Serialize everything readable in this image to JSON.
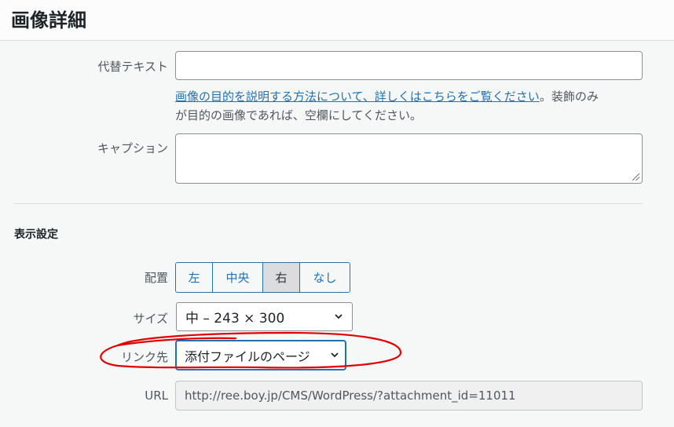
{
  "header": {
    "title": "画像詳細"
  },
  "alt_text": {
    "label": "代替テキスト",
    "value": "",
    "help_link": "画像の目的を説明する方法について、詳しくはこちらをご覧ください",
    "help_suffix": "。装飾のみ",
    "help_line2": "が目的の画像であれば、空欄にしてください。"
  },
  "caption": {
    "label": "キャプション",
    "value": ""
  },
  "display_settings": {
    "title": "表示設定",
    "align": {
      "label": "配置",
      "options": [
        "左",
        "中央",
        "右",
        "なし"
      ],
      "selected": "右"
    },
    "size": {
      "label": "サイズ",
      "value": "中 – 243 × 300"
    },
    "link_to": {
      "label": "リンク先",
      "value": "添付ファイルのページ"
    },
    "url": {
      "label": "URL",
      "value": "http://ree.boy.jp/CMS/WordPress/?attachment_id=11011"
    }
  },
  "colors": {
    "accent": "#2271b1",
    "annotation": "#e00000",
    "label": "#50575e",
    "panel_bg": "#f6f7f7"
  }
}
